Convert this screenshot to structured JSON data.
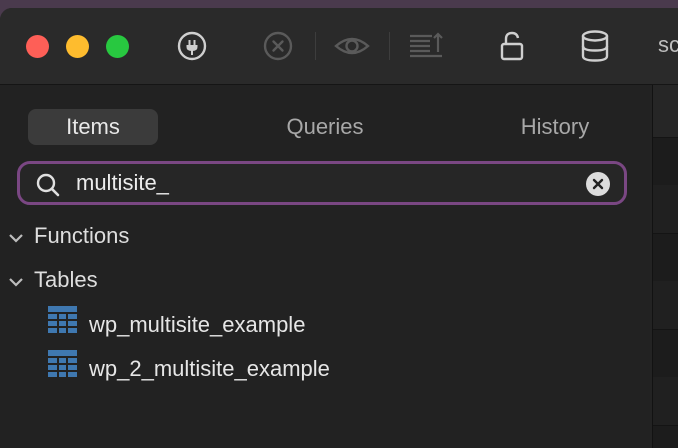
{
  "toolbar": {
    "icons": [
      "plug-icon",
      "stop-icon",
      "eye-icon",
      "export-icon",
      "lock-icon",
      "database-icon"
    ],
    "overflow_text": "sc"
  },
  "sidebar": {
    "tabs": [
      {
        "label": "Items",
        "active": true
      },
      {
        "label": "Queries",
        "active": false
      },
      {
        "label": "History",
        "active": false
      }
    ],
    "search": {
      "value": "multisite_"
    },
    "sections": [
      {
        "label": "Functions",
        "expanded": true,
        "items": []
      },
      {
        "label": "Tables",
        "expanded": true,
        "items": [
          {
            "label": "wp_multisite_example"
          },
          {
            "label": "wp_2_multisite_example"
          }
        ]
      }
    ]
  },
  "colors": {
    "accent_focus_ring": "#7a4783",
    "close": "#fe5f57",
    "minimize": "#febc2e",
    "maximize": "#28c840",
    "table_icon": "#3f78b0"
  }
}
